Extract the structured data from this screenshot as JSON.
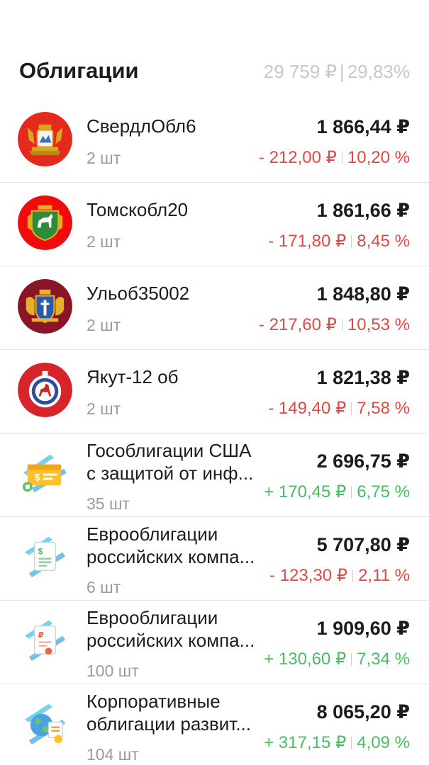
{
  "header": {
    "title": "Облигации",
    "total_value": "29 759 ₽",
    "total_percent": "29,83%"
  },
  "colors": {
    "negative": "#e04a44",
    "positive": "#45bf5f",
    "muted": "#9b9b9b"
  },
  "items": [
    {
      "name_line1": "СвердлОбл6",
      "name_line2": "",
      "qty": "2 шт",
      "price": "1 866,44 ₽",
      "change_abs": "- 212,00 ₽",
      "change_pct": "10,20 %",
      "direction": "neg",
      "icon": "sverdlovsk-coat-of-arms-icon"
    },
    {
      "name_line1": "Томскобл20",
      "name_line2": "",
      "qty": "2 шт",
      "price": "1 861,66 ₽",
      "change_abs": "- 171,80 ₽",
      "change_pct": "8,45 %",
      "direction": "neg",
      "icon": "tomsk-coat-of-arms-icon"
    },
    {
      "name_line1": "Ульоб35002",
      "name_line2": "",
      "qty": "2 шт",
      "price": "1 848,80 ₽",
      "change_abs": "- 217,60 ₽",
      "change_pct": "10,53 %",
      "direction": "neg",
      "icon": "ulyanovsk-coat-of-arms-icon"
    },
    {
      "name_line1": "Якут-12 об",
      "name_line2": "",
      "qty": "2 шт",
      "price": "1 821,38 ₽",
      "change_abs": "- 149,40 ₽",
      "change_pct": "7,58 %",
      "direction": "neg",
      "icon": "yakutia-coat-of-arms-icon"
    },
    {
      "name_line1": "Гособлигации США",
      "name_line2": "с защитой от инф...",
      "qty": "35 шт",
      "price": "2 696,75 ₽",
      "change_abs": "+ 170,45 ₽",
      "change_pct": "6,75 %",
      "direction": "pos",
      "icon": "dollar-card-icon"
    },
    {
      "name_line1": "Еврооблигации",
      "name_line2": "российских компа...",
      "qty": "6 шт",
      "price": "5 707,80 ₽",
      "change_abs": "- 123,30 ₽",
      "change_pct": "2,11 %",
      "direction": "neg",
      "icon": "dollar-document-icon"
    },
    {
      "name_line1": "Еврооблигации",
      "name_line2": "российских компа...",
      "qty": "100 шт",
      "price": "1 909,60 ₽",
      "change_abs": "+ 130,60 ₽",
      "change_pct": "7,34 %",
      "direction": "pos",
      "icon": "ruble-document-icon"
    },
    {
      "name_line1": "Корпоративные",
      "name_line2": "облигации развит...",
      "qty": "104 шт",
      "price": "8 065,20 ₽",
      "change_abs": "+ 317,15 ₽",
      "change_pct": "4,09 %",
      "direction": "pos",
      "icon": "globe-bonds-icon"
    }
  ]
}
